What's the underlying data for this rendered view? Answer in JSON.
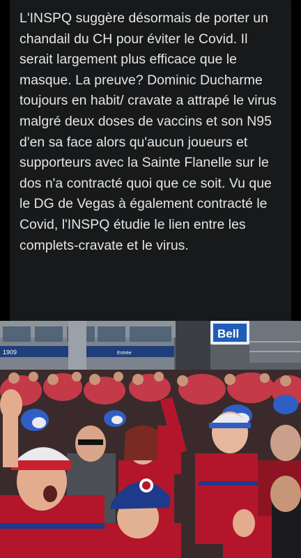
{
  "post": {
    "text": "L'INSPQ suggère désormais de porter un chandail du CH pour éviter le Covid. Il serait largement plus efficace que le masque. La preuve? Dominic Ducharme toujours en habit/ cravate a attrapé le virus malgré deux doses de vaccins et son N95 d'en sa face alors qu'aucun joueurs et supporteurs avec la Sainte Flanelle sur le dos n'a contracté quoi que ce soit. Vu que le DG de Vegas à également contracté le Covid, l'INSPQ étudie le lien entre les complets-cravate et le virus."
  },
  "photo": {
    "sign_bell": "Bell",
    "sign_left": "1909",
    "sign_center": "Entrée",
    "colors": {
      "jersey_red": "#b3162b",
      "jersey_blue": "#1e3a8a",
      "sky": "#c8ccd2"
    }
  }
}
